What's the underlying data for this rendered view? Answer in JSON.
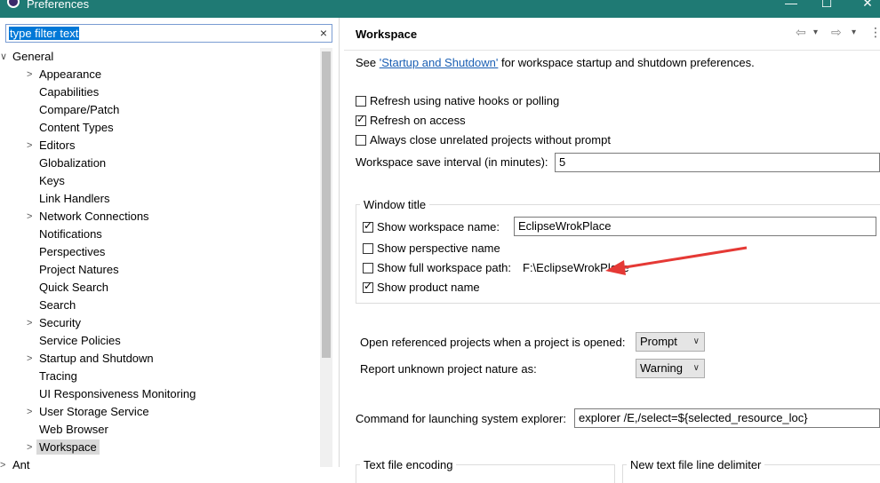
{
  "window": {
    "title": "Preferences",
    "minimize": "—",
    "maximize": "☐",
    "close": "✕"
  },
  "filter": {
    "value": "type filter text",
    "clear_glyph": "×"
  },
  "tree": [
    {
      "label": "General",
      "arrow": "∨",
      "level": 0
    },
    {
      "label": "Appearance",
      "arrow": ">",
      "level": 1
    },
    {
      "label": "Capabilities",
      "arrow": "",
      "level": 1
    },
    {
      "label": "Compare/Patch",
      "arrow": "",
      "level": 1
    },
    {
      "label": "Content Types",
      "arrow": "",
      "level": 1
    },
    {
      "label": "Editors",
      "arrow": ">",
      "level": 1
    },
    {
      "label": "Globalization",
      "arrow": "",
      "level": 1
    },
    {
      "label": "Keys",
      "arrow": "",
      "level": 1
    },
    {
      "label": "Link Handlers",
      "arrow": "",
      "level": 1
    },
    {
      "label": "Network Connections",
      "arrow": ">",
      "level": 1
    },
    {
      "label": "Notifications",
      "arrow": "",
      "level": 1
    },
    {
      "label": "Perspectives",
      "arrow": "",
      "level": 1
    },
    {
      "label": "Project Natures",
      "arrow": "",
      "level": 1
    },
    {
      "label": "Quick Search",
      "arrow": "",
      "level": 1
    },
    {
      "label": "Search",
      "arrow": "",
      "level": 1
    },
    {
      "label": "Security",
      "arrow": ">",
      "level": 1
    },
    {
      "label": "Service Policies",
      "arrow": "",
      "level": 1
    },
    {
      "label": "Startup and Shutdown",
      "arrow": ">",
      "level": 1
    },
    {
      "label": "Tracing",
      "arrow": "",
      "level": 1
    },
    {
      "label": "UI Responsiveness Monitoring",
      "arrow": "",
      "level": 1
    },
    {
      "label": "User Storage Service",
      "arrow": ">",
      "level": 1
    },
    {
      "label": "Web Browser",
      "arrow": "",
      "level": 1
    },
    {
      "label": "Workspace",
      "arrow": ">",
      "level": 1,
      "selected": true
    },
    {
      "label": "Ant",
      "arrow": ">",
      "level": 0
    }
  ],
  "page": {
    "title": "Workspace",
    "nav": {
      "back": "⇦",
      "back_menu": "▾",
      "forward": "⇨",
      "forward_menu": "▾",
      "more": "⋮"
    },
    "see_prefix": "See ",
    "see_link": "'Startup and Shutdown'",
    "see_suffix": " for workspace startup and shutdown preferences.",
    "refresh_native": {
      "label": "Refresh using native hooks or polling",
      "checked": false
    },
    "refresh_access": {
      "label": "Refresh on access",
      "checked": true
    },
    "always_close": {
      "label": "Always close unrelated projects without prompt",
      "checked": false
    },
    "save_interval": {
      "label": "Workspace save interval (in minutes):",
      "value": "5"
    },
    "window_title": {
      "group_label": "Window title",
      "show_workspace_name": {
        "label": "Show workspace name:",
        "checked": true,
        "value": "EclipseWrokPlace"
      },
      "show_perspective_name": {
        "label": "Show perspective name",
        "checked": false
      },
      "show_full_path": {
        "label": "Show full workspace path:",
        "checked": false,
        "value": "F:\\EclipseWrokPlace"
      },
      "show_product_name": {
        "label": "Show product name",
        "checked": true
      }
    },
    "open_referenced": {
      "label": "Open referenced projects when a project is opened:",
      "value": "Prompt"
    },
    "report_unknown": {
      "label": "Report unknown project nature as:",
      "value": "Warning"
    },
    "explorer_cmd": {
      "label": "Command for launching system explorer:",
      "value": "explorer /E,/select=${selected_resource_loc}"
    },
    "text_encoding_label": "Text file encoding",
    "line_delimiter_label": "New text file line delimiter"
  },
  "colors": {
    "titlebar": "#1f7a74",
    "selection": "#0078d7",
    "arrow": "#e53935",
    "link": "#1a5fb4"
  },
  "check_glyph": "✓"
}
